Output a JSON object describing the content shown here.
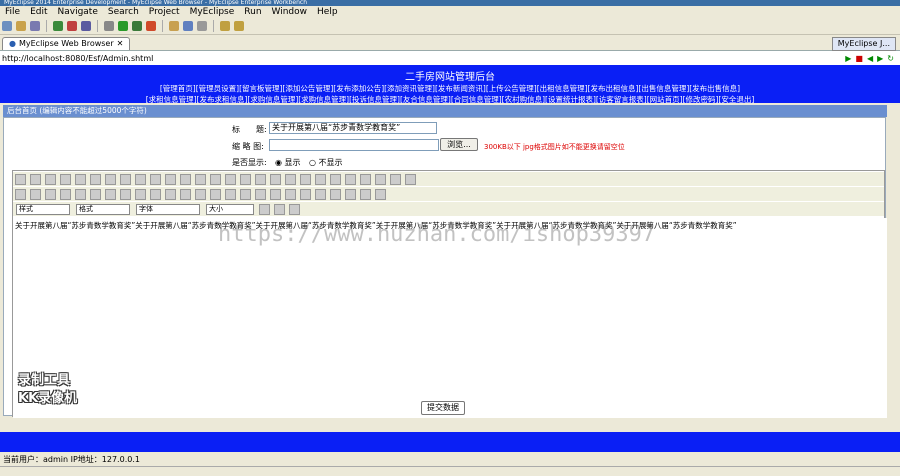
{
  "window": {
    "title": "MyEclipse 2014 Enterprise Development - MyEclipse Web Browser - MyEclipse Enterprise Workbench"
  },
  "menu": [
    "File",
    "Edit",
    "Navigate",
    "Search",
    "Project",
    "MyEclipse",
    "Run",
    "Window",
    "Help"
  ],
  "tabs": {
    "browser_tab": "MyEclipse Web Browser",
    "perspective_tab": "MyEclipse J..."
  },
  "address": {
    "url": "http://localhost:8080/Esf/Admin.shtml"
  },
  "banner": {
    "title": "二手房网站管理后台",
    "links_row1": "[管理首页][管理员设置][留言板管理][添加公告管理][发布添加公告][添加资讯管理][发布新闻资讯][上传公告管理][出租信息管理][发布出租信息][出售信息管理][发布出售信息]",
    "links_row2": "[求租信息管理][发布求租信息][求购信息管理][求购信息管理][投诉信息管理][友合信息管理][合同信息管理][农村购信息][设置统计报表][访客留言报表][网站首页][修改密码][安全退出]"
  },
  "breadcrumb": "后台首页  (编辑内容不能超过5000个字符)",
  "form": {
    "title_label": "标　　题:",
    "title_value": "关于开展第八届“苏步青数学教育奖”",
    "image_label": "缩 略 图:",
    "browse_label": "浏览...",
    "image_hint": "300KB以下 jpg格式图片如不能更换请留空位",
    "display_label": "是否显示:",
    "display_show": "显示",
    "display_hide": "不显示"
  },
  "editor": {
    "style_label": "样式",
    "format_label": "格式",
    "font_label": "字体",
    "size_label": "大小",
    "content": "关于开展第八届“苏步青数学教育奖”关于开展第八届“苏步青数学教育奖”关于开展第八届“苏步青数学教育奖”关于开展第八届“苏步青数学教育奖”关于开展第八届“苏步青数学教育奖”关于开展第八届“苏步青数学教育奖”"
  },
  "submit_label": "提交数据",
  "status": "当前用户：admin  IP地址：127.0.0.1",
  "watermark": "https://www.huzhan.com/ishop39397",
  "logo": {
    "line1": "录制工具",
    "line2": "KK录像机"
  }
}
